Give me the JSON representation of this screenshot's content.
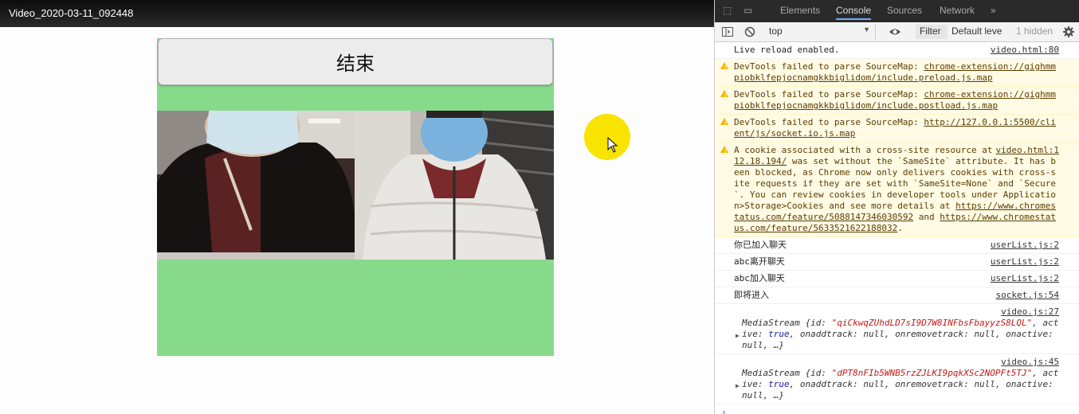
{
  "title_bar": {
    "title": "Video_2020-03-11_092448"
  },
  "app": {
    "end_button": "结束"
  },
  "devtools": {
    "tabs": [
      "Elements",
      "Console",
      "Sources",
      "Network",
      "»"
    ],
    "toolbar": {
      "context": "top",
      "filter": "Filter",
      "level": "Default leve",
      "hidden": "1 hidden"
    },
    "messages": [
      {
        "type": "log",
        "text": "Live reload enabled.",
        "source": "video.html:80"
      },
      {
        "type": "warn",
        "prefix": "DevTools failed to parse SourceMap: ",
        "link": "chrome-extension://gighmmpiobklfepjocnamgkkbiglidom/include.preload.js.map"
      },
      {
        "type": "warn",
        "prefix": "DevTools failed to parse SourceMap: ",
        "link": "chrome-extension://gighmmpiobklfepjocnamgkkbiglidom/include.postload.js.map"
      },
      {
        "type": "warn",
        "prefix": "DevTools failed to parse SourceMap: ",
        "link": "http://127.0.0.1:5500/client/js/socket.io.js.map"
      },
      {
        "type": "warn",
        "source": "video.html:1",
        "cookie_text_1": "A cookie associated with a cross-site resource at ",
        "cookie_link_1": "http://47.112.18.194/",
        "cookie_text_2": " was set without the `SameSite` attribute. It has been blocked, as Chrome now only delivers cookies with cross-site requests if they are set with `SameSite=None` and `Secure`. You can review cookies in developer tools under Application>Storage>Cookies and see more details at ",
        "cookie_link_2": "https://www.chromestatus.com/feature/5088147346030592",
        "cookie_text_3": " and ",
        "cookie_link_3": "https://www.chromestatus.com/feature/5633521622188032",
        "cookie_text_4": "."
      },
      {
        "type": "log",
        "text": "你已加入聊天",
        "source": "userList.js:2"
      },
      {
        "type": "log",
        "text": "abc离开聊天",
        "source": "userList.js:2"
      },
      {
        "type": "log",
        "text": "abc加入聊天",
        "source": "userList.js:2"
      },
      {
        "type": "log",
        "text": "即将进入",
        "source": "socket.js:54"
      }
    ],
    "objects": [
      {
        "source": "video.js:27",
        "label": "MediaStream ",
        "id": "\"qiCkwqZUhdLD7sI9D7W8INFbsFbayyzS8LQL\""
      },
      {
        "source": "video.js:45",
        "label": "MediaStream ",
        "id": "\"dPT8nFIb5WNB5rzZJLKI9pqkXSc2NOPFt5TJ\""
      }
    ],
    "object_tokens": {
      "open": "{id: ",
      "active_key": ", active: ",
      "true": "true",
      "onaddtrack": ", onaddtrack: ",
      "null": "null",
      "onremovetrack": ", onremovetrack: ",
      "onactive": ", onactive: ",
      "rest": "null, …}"
    },
    "prompt": "›"
  }
}
